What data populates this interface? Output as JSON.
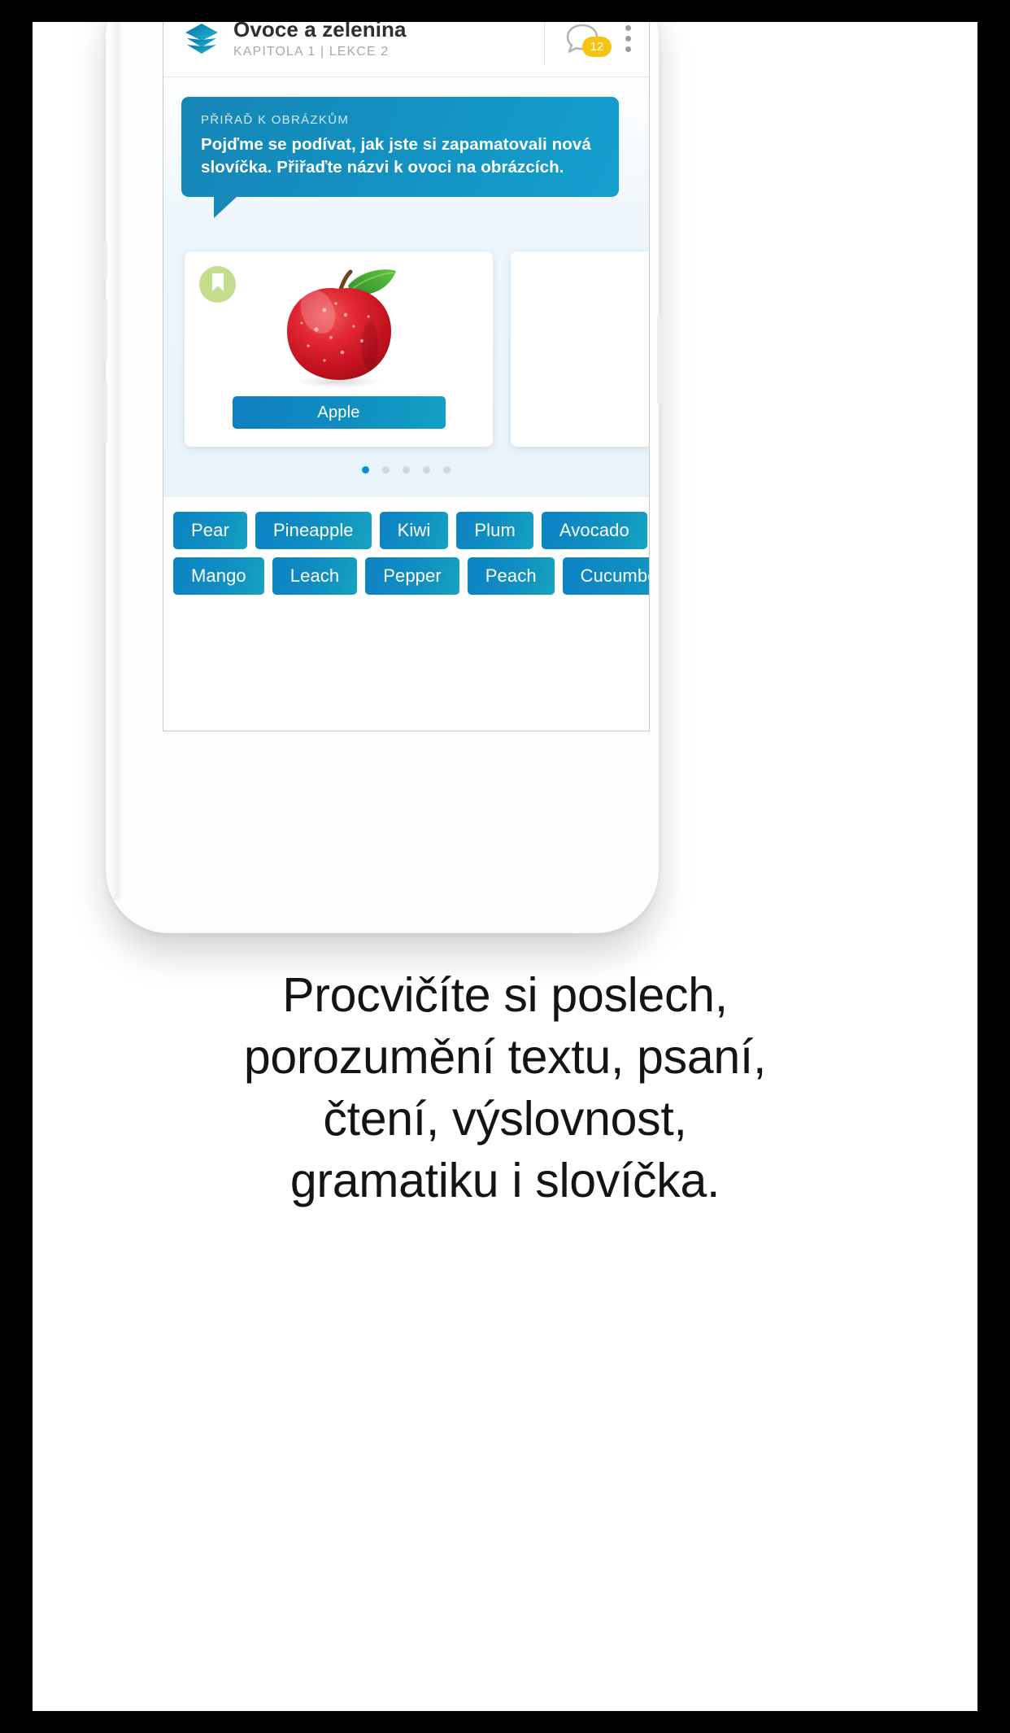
{
  "app": {
    "header": {
      "logo_icon": "layers-stack-icon",
      "title": "Ovoce a zelenina",
      "subtitle": "KAPITOLA 1 | LEKCE 2",
      "chat_icon": "chat-bubble-icon",
      "chat_badge": "12",
      "menu_icon": "kebab-menu-icon"
    },
    "instruction": {
      "kicker": "PŘIŘAĎ K OBRÁZKŮM",
      "text": "Pojďme se podívat, jak jste si zapamatovali nová slovíčka. Přiřaďte názvi k ovoci na obrázcích."
    },
    "card": {
      "bookmark_icon": "bookmark-icon",
      "image_alt": "red-apple-photo",
      "answer_label": "Apple"
    },
    "pagination": {
      "total": 5,
      "active_index": 0
    },
    "wordbank": {
      "row1": [
        "Pear",
        "Pineapple",
        "Kiwi",
        "Plum",
        "Avocado"
      ],
      "row2": [
        "Mango",
        "Leach",
        "Pepper",
        "Peach",
        "Cucumber"
      ]
    }
  },
  "caption": {
    "line1": "Procvičíte si poslech,",
    "line2": "porozumění textu, psaní,",
    "line3": "čtení, výslovnost,",
    "line4": "gramatiku i slovíčka."
  },
  "colors": {
    "accent_blue": "#1090c2",
    "badge_yellow": "#f5c413",
    "bookmark_green": "#c7dd8e",
    "dot_active": "#0b8ed6"
  }
}
